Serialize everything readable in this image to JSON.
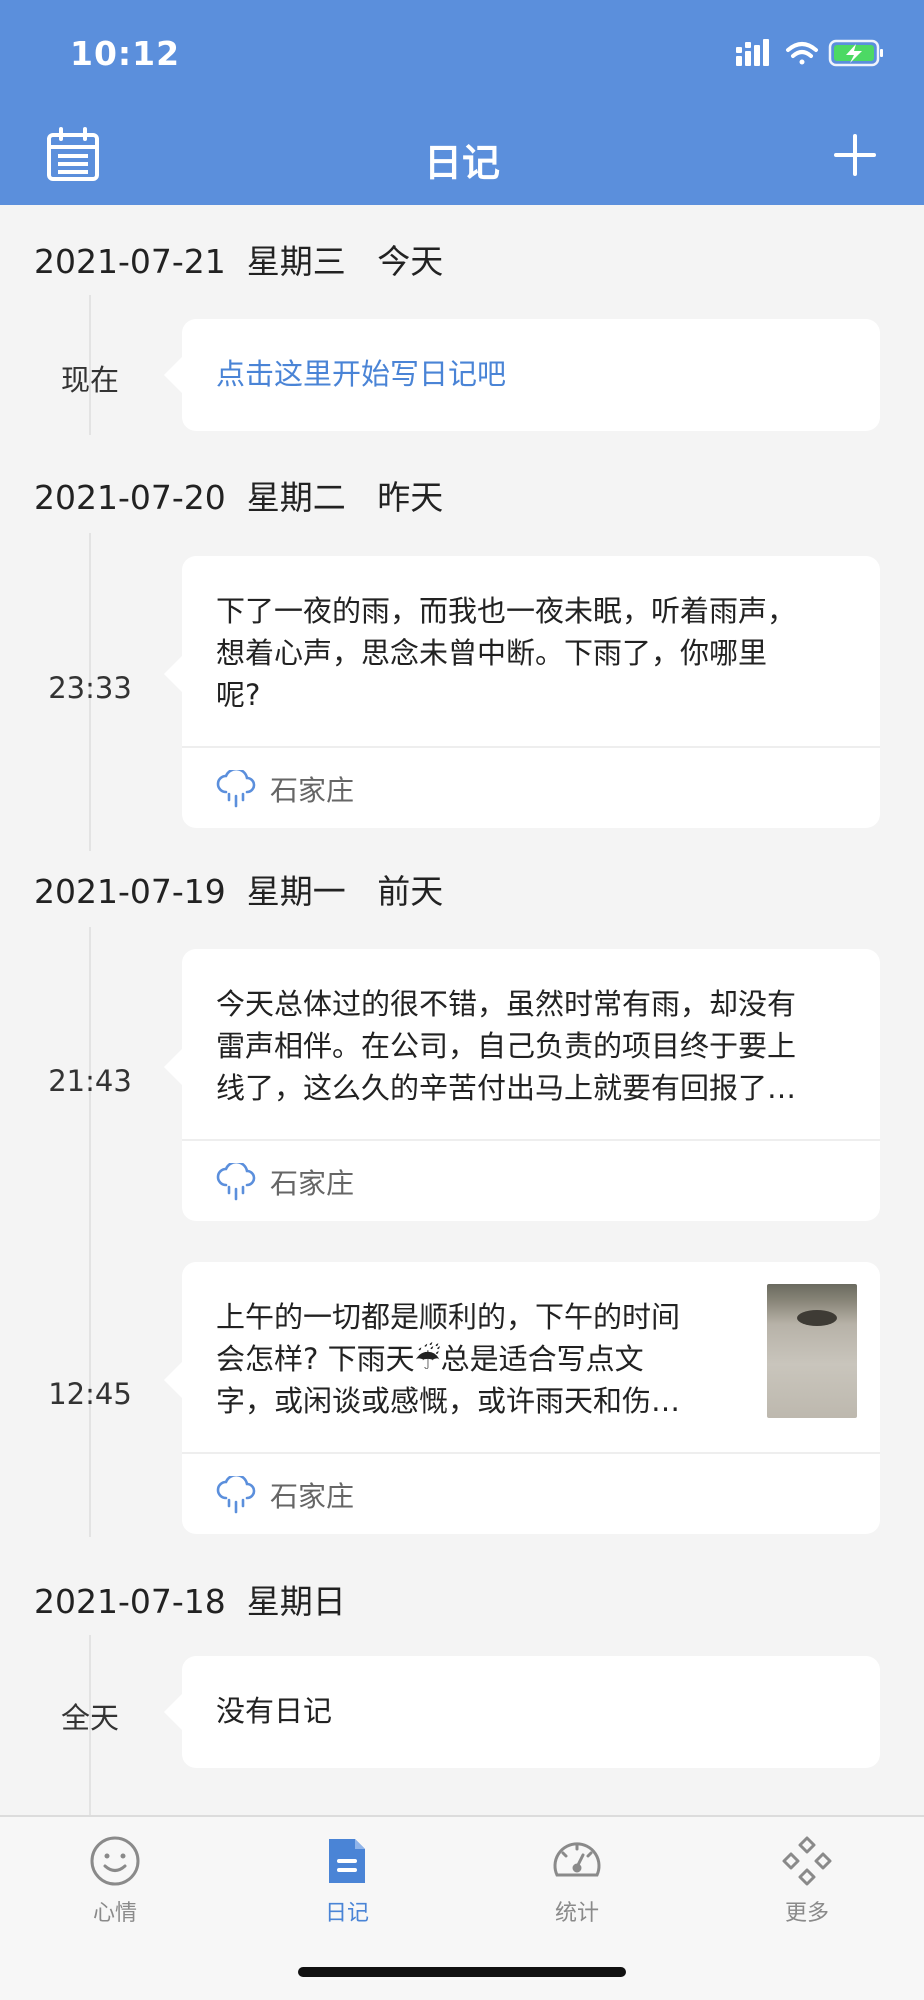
{
  "status_bar": {
    "time": "10:12"
  },
  "nav": {
    "title": "日记",
    "left_icon": "calendar-icon",
    "right_icon": "plus-icon"
  },
  "colors": {
    "primary": "#5b8fdc",
    "link": "#4a84d6",
    "background": "#f4f4f4"
  },
  "days": [
    {
      "date": "2021-07-21",
      "weekday": "星期三",
      "relative": "今天",
      "entries": [
        {
          "time": "现在",
          "text": "点击这里开始写日记吧",
          "kind": "prompt"
        }
      ]
    },
    {
      "date": "2021-07-20",
      "weekday": "星期二",
      "relative": "昨天",
      "entries": [
        {
          "time": "23:33",
          "lines": [
            "下了一夜的雨，而我也一夜未眠，听着雨声，",
            "想着心声，思念未曾中断。下雨了，你哪里",
            "呢?"
          ],
          "location": "石家庄",
          "weather_icon": "rain-cloud-icon"
        }
      ]
    },
    {
      "date": "2021-07-19",
      "weekday": "星期一",
      "relative": "前天",
      "entries": [
        {
          "time": "21:43",
          "lines": [
            "今天总体过的很不错，虽然时常有雨，却没有",
            "雷声相伴。在公司，自己负责的项目终于要上",
            "线了，这么久的辛苦付出马上就要有回报了…"
          ],
          "location": "石家庄",
          "weather_icon": "rain-cloud-icon"
        },
        {
          "time": "12:45",
          "lines": [
            "上午的一切都是顺利的，下午的时间",
            "会怎样? 下雨天☔总是适合写点文",
            "字，或闲谈或感慨，或许雨天和伤…"
          ],
          "location": "石家庄",
          "weather_icon": "rain-cloud-icon",
          "has_photo": true
        }
      ]
    },
    {
      "date": "2021-07-18",
      "weekday": "星期日",
      "relative": "",
      "entries": [
        {
          "time": "全天",
          "text": "没有日记",
          "kind": "empty"
        }
      ]
    }
  ],
  "tabs": [
    {
      "label": "心情",
      "icon": "smiley-icon",
      "active": false
    },
    {
      "label": "日记",
      "icon": "document-icon",
      "active": true
    },
    {
      "label": "统计",
      "icon": "gauge-icon",
      "active": false
    },
    {
      "label": "更多",
      "icon": "diamonds-grid-icon",
      "active": false
    }
  ]
}
